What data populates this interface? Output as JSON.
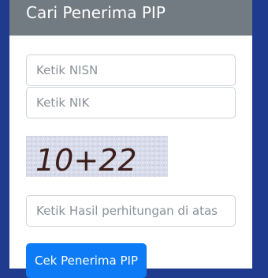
{
  "header": {
    "title": "Cari Penerima PIP"
  },
  "form": {
    "nisn_placeholder": "Ketik NISN",
    "nik_placeholder": "Ketik NIK",
    "captcha_text": "10+22",
    "captcha_answer_placeholder": "Ketik Hasil perhitungan di atas",
    "submit_label": "Cek Penerima PIP"
  },
  "colors": {
    "background": "#1f3b8e",
    "header": "#727a82",
    "button": "#0d7bf5"
  }
}
